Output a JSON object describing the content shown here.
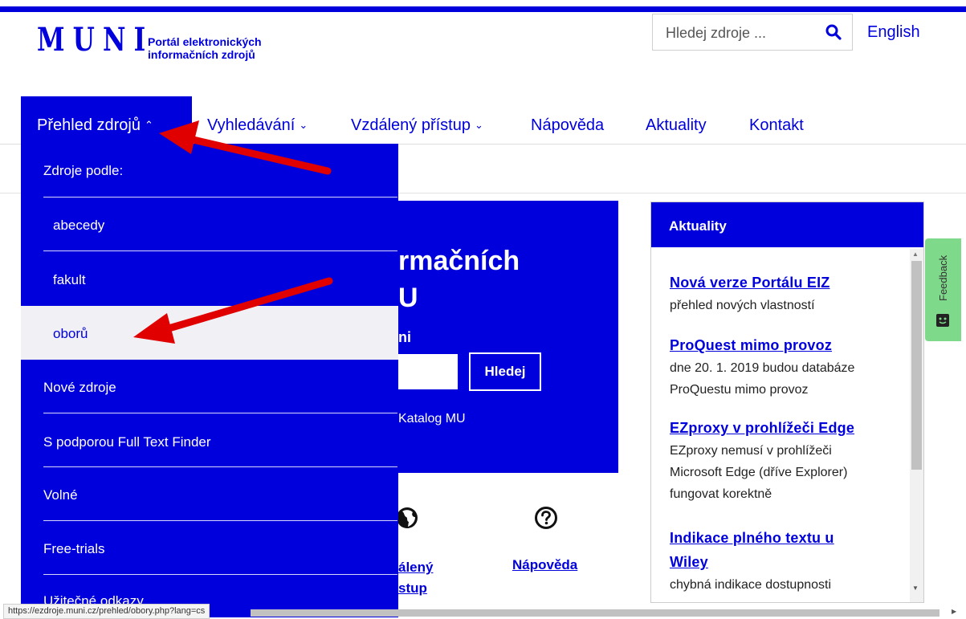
{
  "header": {
    "logo_text": "MUNI",
    "logo_subtitle_line1": "Portál elektronických",
    "logo_subtitle_line2": "informačních zdrojů",
    "search_placeholder": "Hledej zdroje ...",
    "language_link": "English"
  },
  "nav": {
    "items": [
      {
        "label": "Přehled zdrojů",
        "chevron": "up",
        "active": true
      },
      {
        "label": "Vyhledávání",
        "chevron": "down"
      },
      {
        "label": "Vzdálený přístup",
        "chevron": "down"
      },
      {
        "label": "Nápověda"
      },
      {
        "label": "Aktuality"
      },
      {
        "label": "Kontakt"
      }
    ]
  },
  "dropdown": {
    "header": "Zdroje podle:",
    "items": [
      "abecedy",
      "fakult",
      "oborů",
      "Nové zdroje",
      "S podporou Full Text Finder",
      "Volné",
      "Free-trials",
      "Užitečné odkazy"
    ],
    "highlighted": "oborů"
  },
  "hero": {
    "title_line1": "rmačních",
    "title_line2": "U",
    "label_fragment": "ni",
    "search_button": "Hledej",
    "catalog_link": "Katalog MU"
  },
  "quick_links": {
    "remote_line1": "álený",
    "remote_line2": "stup",
    "help": "Nápověda"
  },
  "news": {
    "heading": "Aktuality",
    "items": [
      {
        "title": "Nová verze Portálu EIZ",
        "desc": [
          "přehled nových vlastností"
        ]
      },
      {
        "title": "ProQuest mimo provoz",
        "desc": [
          "dne 20. 1. 2019 budou databáze",
          "ProQuestu mimo provoz"
        ]
      },
      {
        "title": "EZproxy v prohlížeči Edge",
        "desc": [
          "EZproxy nemusí v prohlížeči",
          "Microsoft Edge (dříve Explorer)",
          "fungovat korektně"
        ]
      },
      {
        "title_lines": [
          "Indikace plného textu u",
          "Wiley"
        ],
        "desc": [
          "chybná indikace dostupnosti"
        ]
      }
    ]
  },
  "feedback_label": "Feedback",
  "status_url": "https://ezdroje.muni.cz/prehled/obory.php?lang=cs",
  "colors": {
    "brand": "#0000dc",
    "arrow": "#e00000",
    "feedback": "#7fd98a"
  }
}
